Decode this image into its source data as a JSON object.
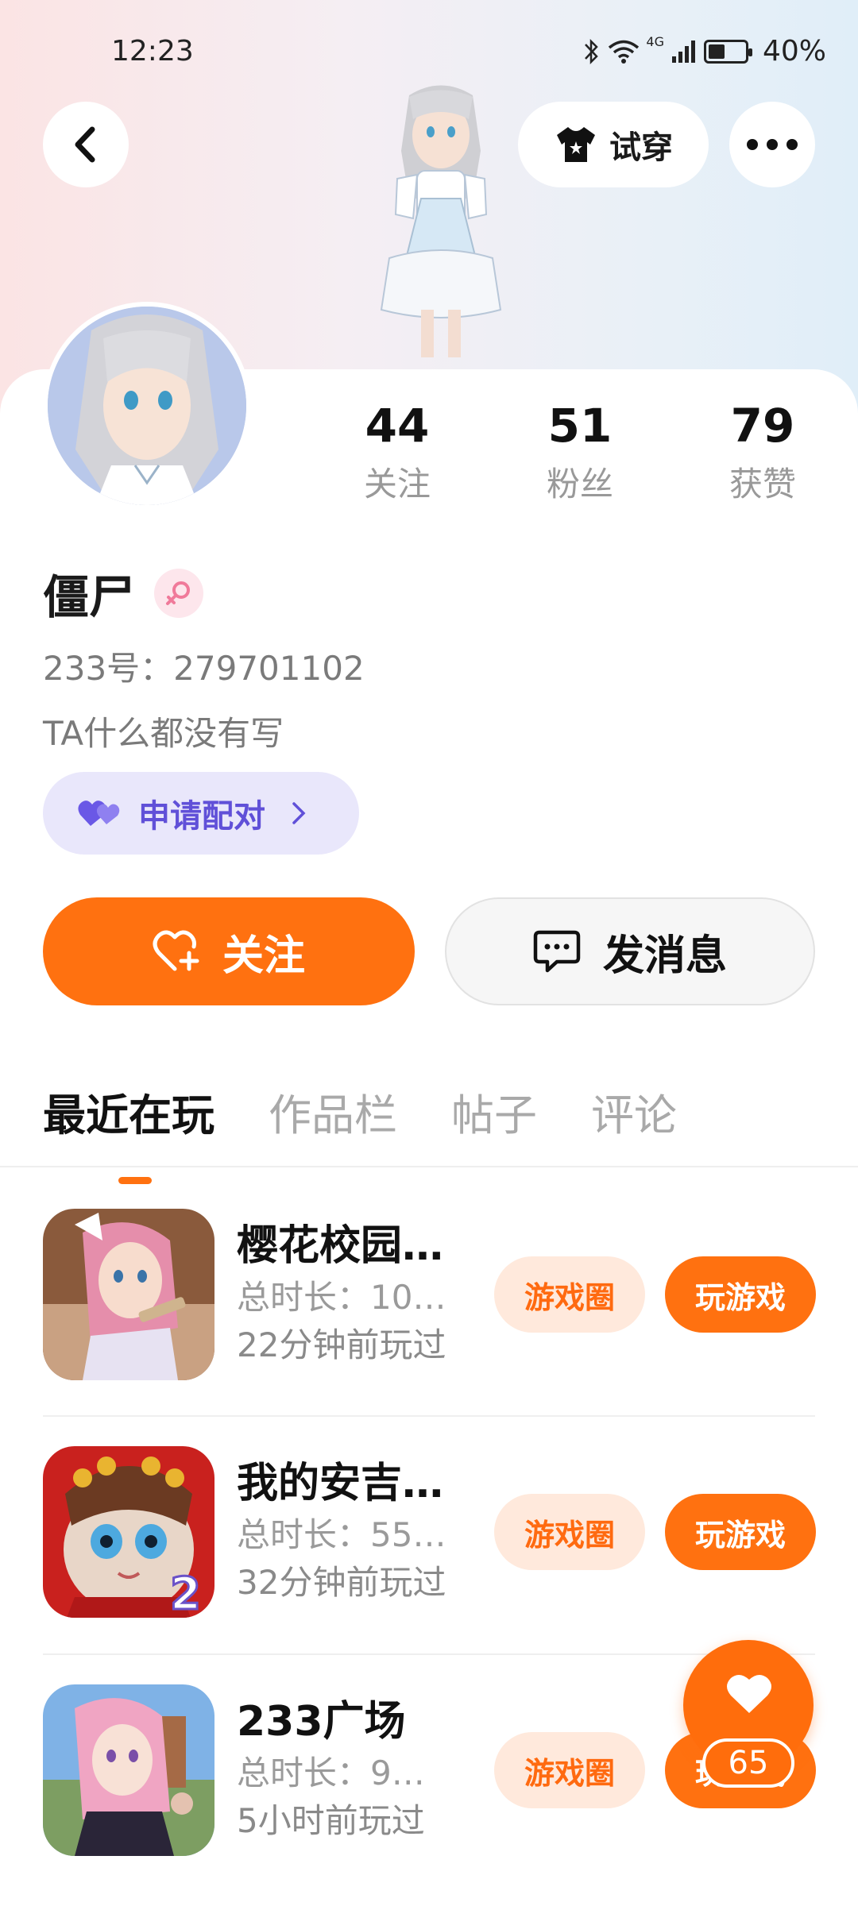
{
  "status_bar": {
    "time": "12:23",
    "battery": "40%",
    "network": "4G"
  },
  "header": {
    "tryon_label": "试穿"
  },
  "profile": {
    "name": "僵尸",
    "uid": "233号：279701102",
    "bio": "TA什么都没有写",
    "pair_label": "申请配对",
    "stats": [
      {
        "value": "44",
        "label": "关注"
      },
      {
        "value": "51",
        "label": "粉丝"
      },
      {
        "value": "79",
        "label": "获赞"
      }
    ]
  },
  "actions": {
    "follow_label": "关注",
    "message_label": "发消息"
  },
  "tabs": [
    "最近在玩",
    "作品栏",
    "帖子",
    "评论"
  ],
  "games": [
    {
      "title": "樱花校园…",
      "duration": "总时长：10…",
      "last_played": "22分钟前玩过",
      "circle_label": "游戏圈",
      "play_label": "玩游戏"
    },
    {
      "title": "我的安吉…",
      "duration": "总时长：55…",
      "last_played": "32分钟前玩过",
      "circle_label": "游戏圈",
      "play_label": "玩游戏"
    },
    {
      "title": "233广场",
      "duration": "总时长：9…",
      "last_played": "5小时前玩过",
      "circle_label": "游戏圈",
      "play_label": "玩游戏"
    }
  ],
  "fab": {
    "count": "65"
  },
  "colors": {
    "accent": "#ff7110",
    "pair": "#6050d8",
    "circle_bg": "#ffe9dc"
  }
}
